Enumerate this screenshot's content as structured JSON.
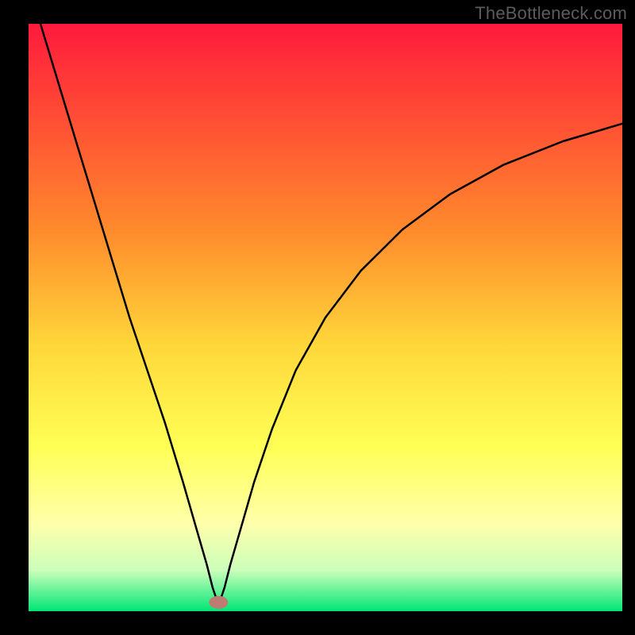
{
  "watermark": "TheBottleneck.com",
  "chart_data": {
    "type": "line",
    "title": "",
    "xlabel": "",
    "ylabel": "",
    "xlim": [
      0,
      100
    ],
    "ylim": [
      0,
      100
    ],
    "background": {
      "type": "vertical-gradient",
      "stops": [
        {
          "offset": 0.0,
          "color": "#ff1a3c"
        },
        {
          "offset": 0.35,
          "color": "#ff8a2c"
        },
        {
          "offset": 0.55,
          "color": "#ffd83a"
        },
        {
          "offset": 0.72,
          "color": "#ffff55"
        },
        {
          "offset": 0.85,
          "color": "#ffffaa"
        },
        {
          "offset": 0.93,
          "color": "#ccffbb"
        },
        {
          "offset": 1.0,
          "color": "#00e676"
        }
      ]
    },
    "marker": {
      "x": 32,
      "y": 1.5,
      "color": "#bd7c73",
      "rx": 1.6,
      "ry": 1.1
    },
    "series": [
      {
        "name": "bottleneck-curve",
        "color": "#000000",
        "stroke_width": 2.5,
        "x": [
          2,
          5,
          8,
          11,
          14,
          17,
          20,
          23,
          26,
          28,
          30,
          31,
          32,
          33,
          34,
          36,
          38,
          41,
          45,
          50,
          56,
          63,
          71,
          80,
          90,
          100
        ],
        "values": [
          100,
          90,
          80,
          70,
          60,
          50,
          41,
          32,
          22,
          15,
          8,
          4,
          1,
          4,
          8,
          15,
          22,
          31,
          41,
          50,
          58,
          65,
          71,
          76,
          80,
          83
        ]
      }
    ]
  }
}
